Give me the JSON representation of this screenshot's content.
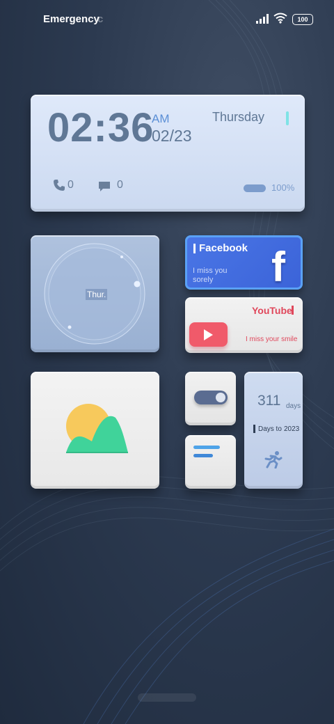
{
  "status_bar": {
    "carrier": "Emergency",
    "carrier_fade": "c",
    "battery": "100"
  },
  "clock": {
    "time": "02:36",
    "ampm": "AM",
    "date": "02/23",
    "weekday": "Thursday",
    "calls": "0",
    "messages": "0",
    "battery_percent": "100%"
  },
  "dial": {
    "label": "Thur."
  },
  "facebook": {
    "title": "Facebook",
    "text": "I miss you sorely",
    "logo": "f"
  },
  "youtube": {
    "title": "YouTube",
    "text": "I miss your smile"
  },
  "toggle": {
    "state": "on"
  },
  "countdown": {
    "number": "311",
    "unit": "days",
    "label": "Days to",
    "year": "2023"
  },
  "colors": {
    "accent_cyan": "#7fe3e6",
    "facebook_blue": "#3b63d8",
    "youtube_red": "#e0475b"
  },
  "icons": [
    "signal-icon",
    "wifi-icon",
    "phone-icon",
    "message-icon",
    "play-icon",
    "facebook-logo-icon",
    "image-icon",
    "toggle-icon",
    "notes-icon",
    "runner-icon"
  ]
}
